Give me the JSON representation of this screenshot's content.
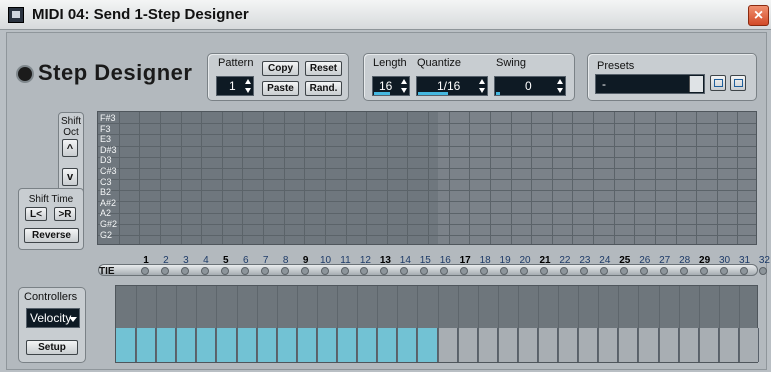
{
  "window": {
    "title": "MIDI 04: Send 1-Step Designer",
    "close_glyph": "×"
  },
  "app": {
    "title": "Step Designer",
    "icon": "gear-icon"
  },
  "pattern": {
    "label": "Pattern",
    "value": "1",
    "copy": "Copy",
    "paste": "Paste",
    "reset": "Reset",
    "rand": "Rand."
  },
  "length": {
    "label": "Length",
    "value": "16"
  },
  "quantize": {
    "label": "Quantize",
    "value": "1/16"
  },
  "swing": {
    "label": "Swing",
    "value": "0"
  },
  "presets": {
    "label": "Presets",
    "value": "-"
  },
  "shift": {
    "oct_label": "Shift Oct",
    "up": "^",
    "down": "v",
    "time_label": "Shift Time",
    "left": "L<",
    "right": ">R",
    "reverse": "Reverse"
  },
  "notes": [
    "F#3",
    "F3",
    "E3",
    "D#3",
    "D3",
    "C#3",
    "C3",
    "B2",
    "A#2",
    "A2",
    "G#2",
    "G2"
  ],
  "steps": [
    "1",
    "2",
    "3",
    "4",
    "5",
    "6",
    "7",
    "8",
    "9",
    "10",
    "11",
    "12",
    "13",
    "14",
    "15",
    "16",
    "17",
    "18",
    "19",
    "20",
    "21",
    "22",
    "23",
    "24",
    "25",
    "26",
    "27",
    "28",
    "29",
    "30",
    "31",
    "32"
  ],
  "tie_label": "TIE",
  "controllers": {
    "label": "Controllers",
    "selected": "Velocity",
    "setup": "Setup"
  },
  "velocity_levels": [
    0.45,
    0.45,
    0.45,
    0.45,
    0.45,
    0.45,
    0.45,
    0.45,
    0.45,
    0.45,
    0.45,
    0.45,
    0.45,
    0.45,
    0.45,
    0.45,
    0.45,
    0.45,
    0.45,
    0.45,
    0.45,
    0.45,
    0.45,
    0.45,
    0.45,
    0.45,
    0.45,
    0.45,
    0.45,
    0.45,
    0.45,
    0.45
  ],
  "colors": {
    "active_velocity": "#72c2d4",
    "inactive_velocity": "#a8aeb3"
  }
}
